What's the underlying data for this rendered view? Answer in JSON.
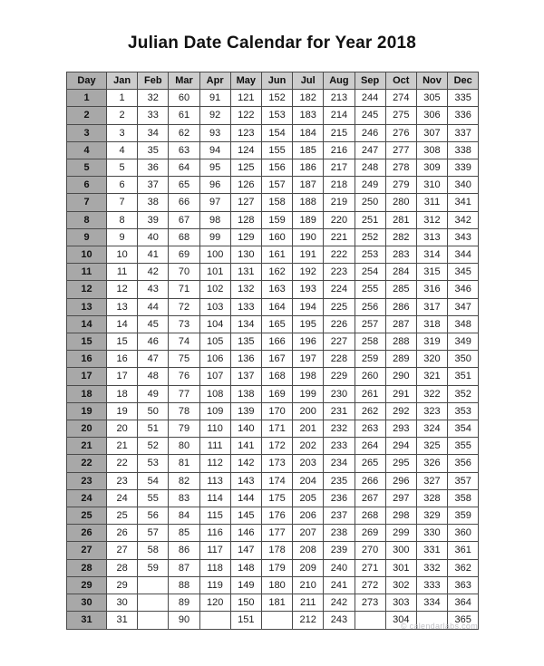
{
  "document": {
    "title": "Julian Date Calendar for Year 2018",
    "year": "2018"
  },
  "footer": {
    "credit": "© calendarlabs.com"
  },
  "colors": {
    "page_background": "#ffffff",
    "day_header_fill": "#b0b0b0",
    "month_header_fill": "#cccccc",
    "day_cell_fill": "#a8a8a8",
    "value_cell_fill": "#ffffff",
    "border": "#4a4a4a",
    "text": "#1b1b1b",
    "footer_text": "#c2c2c7"
  },
  "table": {
    "columns": [
      "Day",
      "Jan",
      "Feb",
      "Mar",
      "Apr",
      "May",
      "Jun",
      "Jul",
      "Aug",
      "Sep",
      "Oct",
      "Nov",
      "Dec"
    ],
    "rows": [
      {
        "day": "1",
        "values": [
          "1",
          "32",
          "60",
          "91",
          "121",
          "152",
          "182",
          "213",
          "244",
          "274",
          "305",
          "335"
        ]
      },
      {
        "day": "2",
        "values": [
          "2",
          "33",
          "61",
          "92",
          "122",
          "153",
          "183",
          "214",
          "245",
          "275",
          "306",
          "336"
        ]
      },
      {
        "day": "3",
        "values": [
          "3",
          "34",
          "62",
          "93",
          "123",
          "154",
          "184",
          "215",
          "246",
          "276",
          "307",
          "337"
        ]
      },
      {
        "day": "4",
        "values": [
          "4",
          "35",
          "63",
          "94",
          "124",
          "155",
          "185",
          "216",
          "247",
          "277",
          "308",
          "338"
        ]
      },
      {
        "day": "5",
        "values": [
          "5",
          "36",
          "64",
          "95",
          "125",
          "156",
          "186",
          "217",
          "248",
          "278",
          "309",
          "339"
        ]
      },
      {
        "day": "6",
        "values": [
          "6",
          "37",
          "65",
          "96",
          "126",
          "157",
          "187",
          "218",
          "249",
          "279",
          "310",
          "340"
        ]
      },
      {
        "day": "7",
        "values": [
          "7",
          "38",
          "66",
          "97",
          "127",
          "158",
          "188",
          "219",
          "250",
          "280",
          "311",
          "341"
        ]
      },
      {
        "day": "8",
        "values": [
          "8",
          "39",
          "67",
          "98",
          "128",
          "159",
          "189",
          "220",
          "251",
          "281",
          "312",
          "342"
        ]
      },
      {
        "day": "9",
        "values": [
          "9",
          "40",
          "68",
          "99",
          "129",
          "160",
          "190",
          "221",
          "252",
          "282",
          "313",
          "343"
        ]
      },
      {
        "day": "10",
        "values": [
          "10",
          "41",
          "69",
          "100",
          "130",
          "161",
          "191",
          "222",
          "253",
          "283",
          "314",
          "344"
        ]
      },
      {
        "day": "11",
        "values": [
          "11",
          "42",
          "70",
          "101",
          "131",
          "162",
          "192",
          "223",
          "254",
          "284",
          "315",
          "345"
        ]
      },
      {
        "day": "12",
        "values": [
          "12",
          "43",
          "71",
          "102",
          "132",
          "163",
          "193",
          "224",
          "255",
          "285",
          "316",
          "346"
        ]
      },
      {
        "day": "13",
        "values": [
          "13",
          "44",
          "72",
          "103",
          "133",
          "164",
          "194",
          "225",
          "256",
          "286",
          "317",
          "347"
        ]
      },
      {
        "day": "14",
        "values": [
          "14",
          "45",
          "73",
          "104",
          "134",
          "165",
          "195",
          "226",
          "257",
          "287",
          "318",
          "348"
        ]
      },
      {
        "day": "15",
        "values": [
          "15",
          "46",
          "74",
          "105",
          "135",
          "166",
          "196",
          "227",
          "258",
          "288",
          "319",
          "349"
        ]
      },
      {
        "day": "16",
        "values": [
          "16",
          "47",
          "75",
          "106",
          "136",
          "167",
          "197",
          "228",
          "259",
          "289",
          "320",
          "350"
        ]
      },
      {
        "day": "17",
        "values": [
          "17",
          "48",
          "76",
          "107",
          "137",
          "168",
          "198",
          "229",
          "260",
          "290",
          "321",
          "351"
        ]
      },
      {
        "day": "18",
        "values": [
          "18",
          "49",
          "77",
          "108",
          "138",
          "169",
          "199",
          "230",
          "261",
          "291",
          "322",
          "352"
        ]
      },
      {
        "day": "19",
        "values": [
          "19",
          "50",
          "78",
          "109",
          "139",
          "170",
          "200",
          "231",
          "262",
          "292",
          "323",
          "353"
        ]
      },
      {
        "day": "20",
        "values": [
          "20",
          "51",
          "79",
          "110",
          "140",
          "171",
          "201",
          "232",
          "263",
          "293",
          "324",
          "354"
        ]
      },
      {
        "day": "21",
        "values": [
          "21",
          "52",
          "80",
          "111",
          "141",
          "172",
          "202",
          "233",
          "264",
          "294",
          "325",
          "355"
        ]
      },
      {
        "day": "22",
        "values": [
          "22",
          "53",
          "81",
          "112",
          "142",
          "173",
          "203",
          "234",
          "265",
          "295",
          "326",
          "356"
        ]
      },
      {
        "day": "23",
        "values": [
          "23",
          "54",
          "82",
          "113",
          "143",
          "174",
          "204",
          "235",
          "266",
          "296",
          "327",
          "357"
        ]
      },
      {
        "day": "24",
        "values": [
          "24",
          "55",
          "83",
          "114",
          "144",
          "175",
          "205",
          "236",
          "267",
          "297",
          "328",
          "358"
        ]
      },
      {
        "day": "25",
        "values": [
          "25",
          "56",
          "84",
          "115",
          "145",
          "176",
          "206",
          "237",
          "268",
          "298",
          "329",
          "359"
        ]
      },
      {
        "day": "26",
        "values": [
          "26",
          "57",
          "85",
          "116",
          "146",
          "177",
          "207",
          "238",
          "269",
          "299",
          "330",
          "360"
        ]
      },
      {
        "day": "27",
        "values": [
          "27",
          "58",
          "86",
          "117",
          "147",
          "178",
          "208",
          "239",
          "270",
          "300",
          "331",
          "361"
        ]
      },
      {
        "day": "28",
        "values": [
          "28",
          "59",
          "87",
          "118",
          "148",
          "179",
          "209",
          "240",
          "271",
          "301",
          "332",
          "362"
        ]
      },
      {
        "day": "29",
        "values": [
          "29",
          "",
          "88",
          "119",
          "149",
          "180",
          "210",
          "241",
          "272",
          "302",
          "333",
          "363"
        ]
      },
      {
        "day": "30",
        "values": [
          "30",
          "",
          "89",
          "120",
          "150",
          "181",
          "211",
          "242",
          "273",
          "303",
          "334",
          "364"
        ]
      },
      {
        "day": "31",
        "values": [
          "31",
          "",
          "90",
          "",
          "151",
          "",
          "212",
          "243",
          "",
          "304",
          "",
          "365"
        ]
      }
    ]
  }
}
